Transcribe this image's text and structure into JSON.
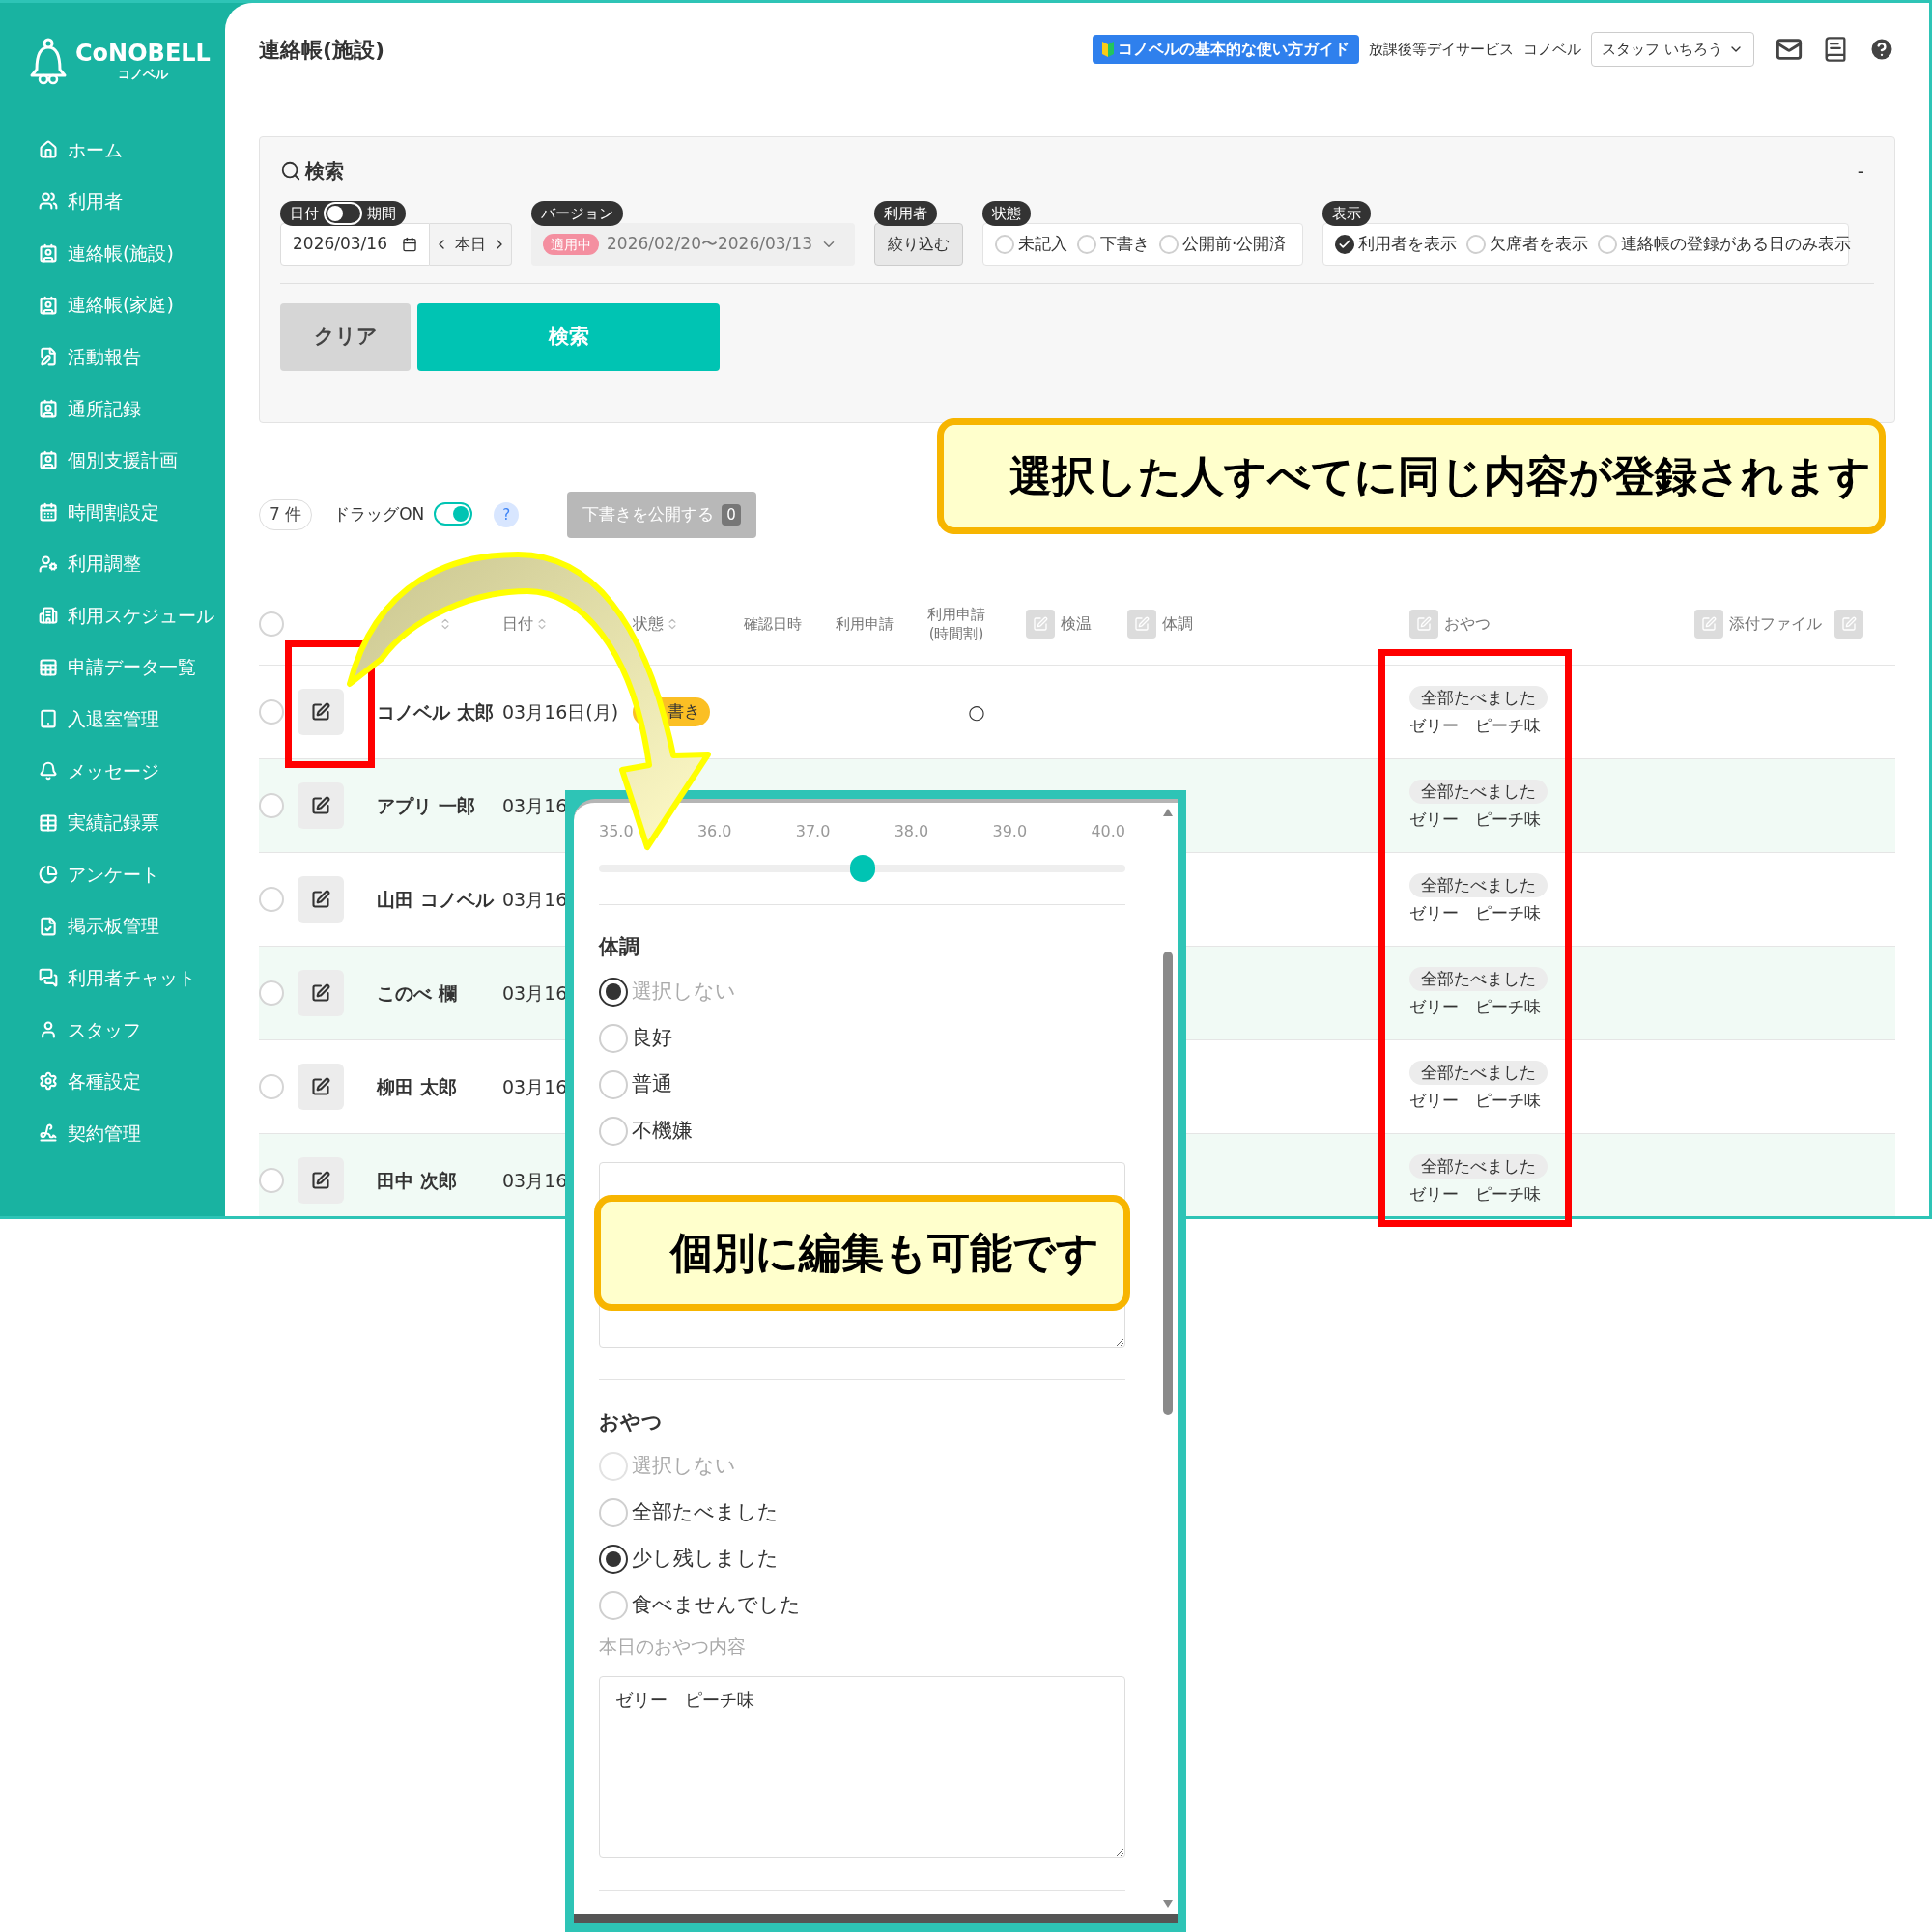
{
  "sidebar": {
    "logo": {
      "name": "CoNOBELL",
      "sub": "コノベル"
    },
    "items": [
      {
        "label": "ホーム"
      },
      {
        "label": "利用者"
      },
      {
        "label": "連絡帳(施設)"
      },
      {
        "label": "連絡帳(家庭)"
      },
      {
        "label": "活動報告"
      },
      {
        "label": "通所記録"
      },
      {
        "label": "個別支援計画"
      },
      {
        "label": "時間割設定"
      },
      {
        "label": "利用調整"
      },
      {
        "label": "利用スケジュール"
      },
      {
        "label": "申請データ一覧"
      },
      {
        "label": "入退室管理"
      },
      {
        "label": "メッセージ"
      },
      {
        "label": "実績記録票"
      },
      {
        "label": "アンケート"
      },
      {
        "label": "掲示板管理"
      },
      {
        "label": "利用者チャット"
      },
      {
        "label": "スタッフ"
      },
      {
        "label": "各種設定"
      },
      {
        "label": "契約管理"
      }
    ]
  },
  "header": {
    "title": "連絡帳(施設)",
    "guide_button": "コノベルの基本的な使い方ガイド",
    "service": "放課後等デイサービス",
    "facility": "コノベル",
    "staff_select": "スタッフ いちろう"
  },
  "search": {
    "title": "検索",
    "collapse": "-",
    "date": {
      "label_left": "日付",
      "label_right": "期間",
      "on": false,
      "value": "2026/03/16",
      "today": "本日"
    },
    "version": {
      "label": "バージョン",
      "badge": "適用中",
      "range": "2026/02/20〜2026/03/13"
    },
    "user": {
      "label": "利用者",
      "button": "絞り込む"
    },
    "state": {
      "label": "状態",
      "options": [
        {
          "label": "未記入",
          "selected": false
        },
        {
          "label": "下書き",
          "selected": false
        },
        {
          "label": "公開前·公開済",
          "selected": false
        }
      ]
    },
    "display": {
      "label": "表示",
      "options": [
        {
          "label": "利用者を表示",
          "selected": true
        },
        {
          "label": "欠席者を表示",
          "selected": false
        },
        {
          "label": "連絡帳の登録がある日のみ表示",
          "selected": false
        }
      ]
    },
    "clear": "クリア",
    "submit": "検索"
  },
  "toolbar": {
    "count": "7 件",
    "drag": {
      "label": "ドラッグON",
      "on": true
    },
    "help": "?",
    "publish": {
      "label": "下書きを公開する",
      "count": "0"
    }
  },
  "table": {
    "columns": [
      {
        "kind": "check",
        "checked": false
      },
      {
        "kind": "blank"
      },
      {
        "kind": "sort"
      },
      {
        "kind": "sort",
        "label": "日付"
      },
      {
        "kind": "sort",
        "label": "状態"
      },
      {
        "kind": "text",
        "label": "確認日時"
      },
      {
        "kind": "text",
        "label": "利用申請"
      },
      {
        "kind": "text",
        "label": "利用申請\n(時間割)"
      },
      {
        "kind": "editable",
        "label": "検温"
      },
      {
        "kind": "editable",
        "label": "体調"
      },
      {
        "kind": "editable",
        "label": "おやつ"
      },
      {
        "kind": "editable",
        "label": "添付ファイル"
      },
      {
        "kind": "editable"
      }
    ],
    "rows": [
      {
        "checked": false,
        "name": "コノベル 太郎",
        "date": "03月16日(月)",
        "status": "書き",
        "timetable": "○",
        "snack": {
          "result": "全部たべました",
          "note": "ゼリー　ピーチ味"
        }
      },
      {
        "checked": false,
        "name": "アプリ 一郎",
        "date": "03月16",
        "snack": {
          "result": "全部たべました",
          "note": "ゼリー　ピーチ味"
        }
      },
      {
        "checked": false,
        "name": "山田 コノベル",
        "date": "03月16",
        "snack": {
          "result": "全部たべました",
          "note": "ゼリー　ピーチ味"
        }
      },
      {
        "checked": false,
        "name": "このべ 欄",
        "date": "03月16",
        "snack": {
          "result": "全部たべました",
          "note": "ゼリー　ピーチ味"
        }
      },
      {
        "checked": false,
        "name": "柳田 太郎",
        "date": "03月16",
        "snack": {
          "result": "全部たべました",
          "note": "ゼリー　ピーチ味"
        }
      },
      {
        "checked": false,
        "name": "田中 次郎",
        "date": "03月16",
        "snack": {
          "result": "全部たべました",
          "note": "ゼリー　ピーチ味"
        }
      }
    ]
  },
  "callout_top": "選択した人すべてに同じ内容が登録されます",
  "edit_panel": {
    "slider": {
      "ticks": [
        "35.0",
        "36.0",
        "37.0",
        "38.0",
        "39.0",
        "40.0"
      ],
      "level": 0.5
    },
    "condition": {
      "title": "体調",
      "options": [
        {
          "label": "選択しない",
          "selected": true,
          "muted": true
        },
        {
          "label": "良好",
          "selected": false,
          "muted": false
        },
        {
          "label": "普通",
          "selected": false,
          "muted": false
        },
        {
          "label": "不機嫌",
          "selected": false,
          "muted": false
        }
      ]
    },
    "callout": "個別に編集も可能です",
    "snack": {
      "title": "おやつ",
      "options": [
        {
          "label": "選択しない",
          "selected": false,
          "muted": true
        },
        {
          "label": "全部たべました",
          "selected": false,
          "muted": false
        },
        {
          "label": "少し残しました",
          "selected": true,
          "muted": false
        },
        {
          "label": "食べませんでした",
          "selected": false,
          "muted": false
        }
      ],
      "field_label": "本日のおやつ内容",
      "field_value": "ゼリー　ピーチ味"
    }
  }
}
